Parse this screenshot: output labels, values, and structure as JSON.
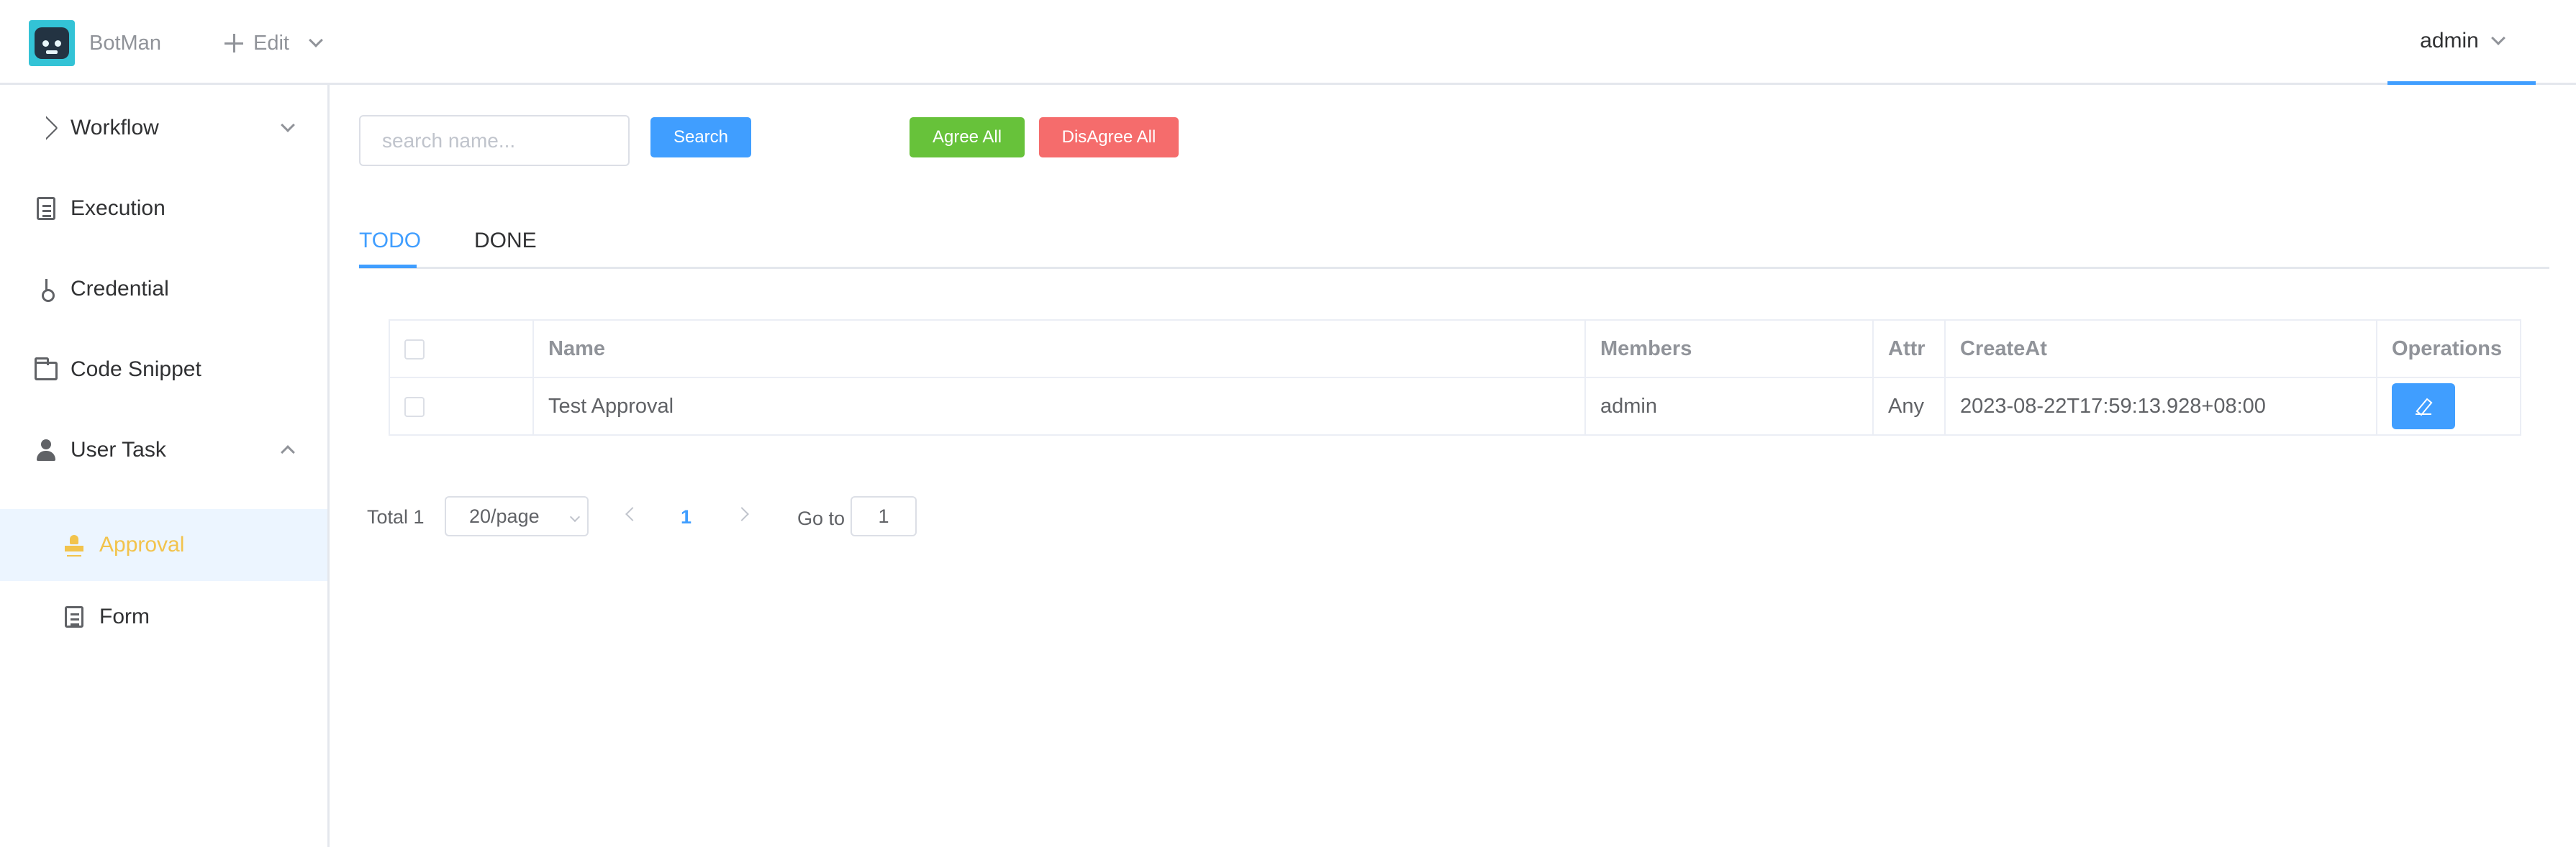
{
  "header": {
    "brand": "BotMan",
    "edit_label": "Edit",
    "user": "admin"
  },
  "sidebar": {
    "items": [
      {
        "label": "Workflow",
        "icon": "send-icon"
      },
      {
        "label": "Execution",
        "icon": "document-icon"
      },
      {
        "label": "Credential",
        "icon": "key-icon"
      },
      {
        "label": "Code Snippet",
        "icon": "folder-icon"
      },
      {
        "label": "User Task",
        "icon": "user-icon"
      }
    ],
    "sub_items": [
      {
        "label": "Approval",
        "icon": "stamp-icon",
        "active": true
      },
      {
        "label": "Form",
        "icon": "form-icon"
      }
    ]
  },
  "toolbar": {
    "search_placeholder": "search name...",
    "search_label": "Search",
    "agree_label": "Agree All",
    "disagree_label": "DisAgree All"
  },
  "tabs": [
    {
      "label": "TODO",
      "active": true
    },
    {
      "label": "DONE"
    }
  ],
  "table": {
    "columns": [
      "Name",
      "Members",
      "Attr",
      "CreateAt",
      "Operations"
    ],
    "rows": [
      {
        "name": "Test Approval",
        "members": "admin",
        "attr": "Any",
        "create_at": "2023-08-22T17:59:13.928+08:00"
      }
    ]
  },
  "pagination": {
    "total": "Total 1",
    "page_size": "20/page",
    "current_page": "1",
    "goto_label": "Go to",
    "goto_value": "1"
  },
  "colors": {
    "primary": "#409eff",
    "success": "#67c23a",
    "danger": "#f56c6c",
    "active_menu": "#f2c34c"
  }
}
